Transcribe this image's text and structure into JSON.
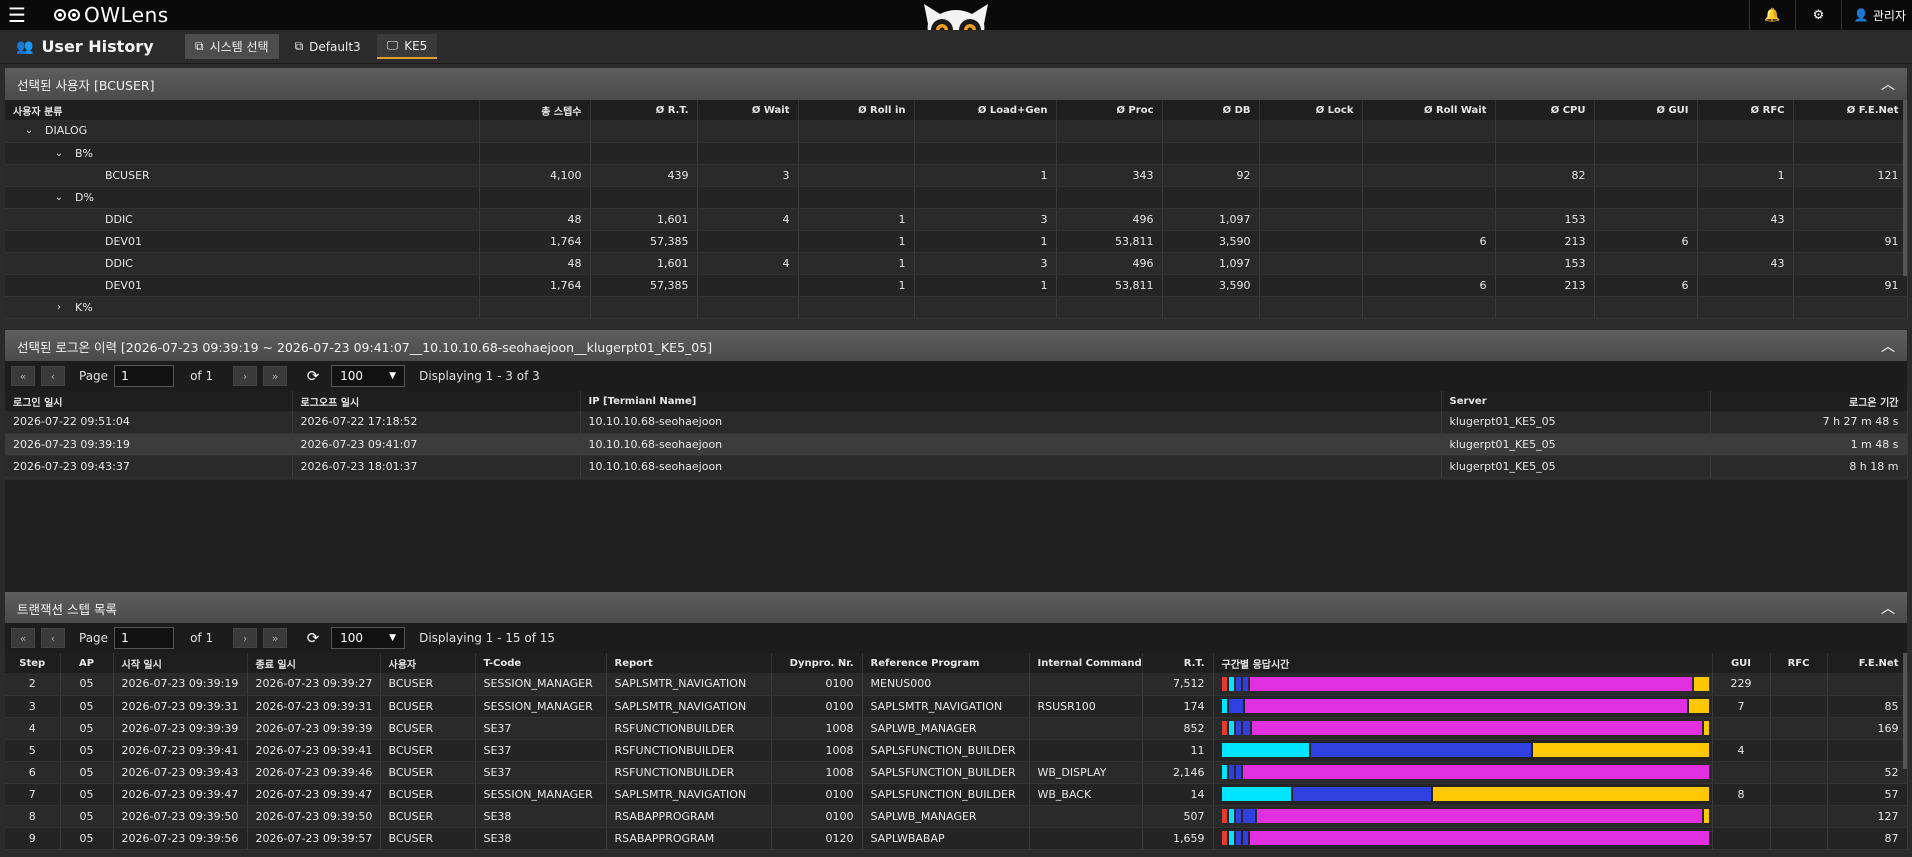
{
  "header": {
    "logo_text": "OWLens",
    "user_label": "관리자",
    "icons": [
      "menu-icon",
      "bell-icon",
      "settings-icon",
      "user-icon"
    ]
  },
  "subheader": {
    "page_title": "User History",
    "tabs": [
      {
        "label": "시스템 선택",
        "state": "active"
      },
      {
        "label": "Default3",
        "state": "normal"
      },
      {
        "label": "KE5",
        "state": "current"
      }
    ]
  },
  "panel1": {
    "title": "선택된 사용자 [BCUSER]",
    "columns": [
      "사용자 분류",
      "총 스텝수",
      "Ø R.T.",
      "Ø Wait",
      "Ø Roll in",
      "Ø Load+Gen",
      "Ø Proc",
      "Ø DB",
      "Ø Lock",
      "Ø Roll Wait",
      "Ø CPU",
      "Ø GUI",
      "Ø RFC",
      "Ø F.E.Net"
    ],
    "rows": [
      {
        "level": 0,
        "toggle": "⌄",
        "label": "DIALOG",
        "cells": [
          "",
          "",
          "",
          "",
          "",
          "",
          "",
          "",
          "",
          "",
          "",
          "",
          ""
        ]
      },
      {
        "level": 1,
        "toggle": "⌄",
        "label": "B%",
        "cells": [
          "",
          "",
          "",
          "",
          "",
          "",
          "",
          "",
          "",
          "",
          "",
          "",
          ""
        ]
      },
      {
        "level": 2,
        "toggle": "",
        "label": "BCUSER",
        "cells": [
          "4,100",
          "439",
          "3",
          "",
          "1",
          "343",
          "92",
          "",
          "",
          "82",
          "",
          "1",
          "121"
        ]
      },
      {
        "level": 1,
        "toggle": "⌄",
        "label": "D%",
        "cells": [
          "",
          "",
          "",
          "",
          "",
          "",
          "",
          "",
          "",
          "",
          "",
          "",
          ""
        ]
      },
      {
        "level": 2,
        "toggle": "",
        "label": "DDIC",
        "cells": [
          "48",
          "1,601",
          "4",
          "1",
          "3",
          "496",
          "1,097",
          "",
          "",
          "153",
          "",
          "43",
          ""
        ]
      },
      {
        "level": 2,
        "toggle": "",
        "label": "DEV01",
        "cells": [
          "1,764",
          "57,385",
          "",
          "1",
          "1",
          "53,811",
          "3,590",
          "",
          "6",
          "213",
          "6",
          "",
          "91"
        ]
      },
      {
        "level": 2,
        "toggle": "",
        "label": "DDIC",
        "cells": [
          "48",
          "1,601",
          "4",
          "1",
          "3",
          "496",
          "1,097",
          "",
          "",
          "153",
          "",
          "43",
          ""
        ]
      },
      {
        "level": 2,
        "toggle": "",
        "label": "DEV01",
        "cells": [
          "1,764",
          "57,385",
          "",
          "1",
          "1",
          "53,811",
          "3,590",
          "",
          "6",
          "213",
          "6",
          "",
          "91"
        ]
      },
      {
        "level": 1,
        "toggle": "›",
        "label": "K%",
        "cells": [
          "",
          "",
          "",
          "",
          "",
          "",
          "",
          "",
          "",
          "",
          "",
          "",
          ""
        ]
      }
    ]
  },
  "panel2": {
    "title": "선택된 로그온 이력 [2026-07-23 09:39:19 ~ 2026-07-23 09:41:07__10.10.10.68-seohaejoon__klugerpt01_KE5_05]",
    "pager": {
      "page_label": "Page",
      "page_value": "1",
      "of_label": "of 1",
      "page_size": "100",
      "displaying": "Displaying  1 - 3  of  3"
    },
    "columns": [
      "로그인 일시",
      "로그오프 일시",
      "IP [Termianl Name]",
      "Server",
      "로그온 기간"
    ],
    "rows": [
      [
        "2026-07-22 09:51:04",
        "2026-07-22 17:18:52",
        "10.10.10.68-seohaejoon",
        "klugerpt01_KE5_05",
        "7 h 27 m 48 s"
      ],
      [
        "2026-07-23 09:39:19",
        "2026-07-23 09:41:07",
        "10.10.10.68-seohaejoon",
        "klugerpt01_KE5_05",
        "1 m 48 s"
      ],
      [
        "2026-07-23 09:43:37",
        "2026-07-23 18:01:37",
        "10.10.10.68-seohaejoon",
        "klugerpt01_KE5_05",
        "8 h 18 m"
      ]
    ]
  },
  "panel3": {
    "title": "트랜잭션 스텝 목록",
    "pager": {
      "page_label": "Page",
      "page_value": "1",
      "of_label": "of 1",
      "page_size": "100",
      "displaying": "Displaying  1 - 15  of  15"
    },
    "columns": [
      "Step",
      "AP",
      "시작 일시",
      "종료 일시",
      "사용자",
      "T-Code",
      "Report",
      "Dynpro. Nr.",
      "Reference Program",
      "Internal Command",
      "R.T.",
      "구간별 응답시간",
      "GUI",
      "RFC",
      "F.E.Net"
    ],
    "colors": {
      "red": "#e53935",
      "cyan": "#00e5ff",
      "blue": "#3040e0",
      "magenta": "#e030e0",
      "yellow": "#ffc800"
    },
    "rows": [
      {
        "cells": [
          "2",
          "05",
          "2026-07-23 09:39:19",
          "2026-07-23 09:39:27",
          "BCUSER",
          "SESSION_MANAGER",
          "SAPLSMTR_NAVIGATION",
          "0100",
          "MENUS000",
          "",
          "7,512"
        ],
        "bar": [
          [
            "red",
            0.8
          ],
          [
            "cyan",
            0.8
          ],
          [
            "blue",
            0.8
          ],
          [
            "blue",
            1.2
          ],
          [
            "magenta",
            89
          ],
          [
            "yellow",
            3
          ]
        ],
        "tail": [
          "229",
          "",
          ""
        ]
      },
      {
        "cells": [
          "3",
          "05",
          "2026-07-23 09:39:31",
          "2026-07-23 09:39:31",
          "BCUSER",
          "SESSION_MANAGER",
          "SAPLSMTR_NAVIGATION",
          "0100",
          "SAPLSMTR_NAVIGATION",
          "RSUSR100",
          "174"
        ],
        "bar": [
          [
            "cyan",
            0.8
          ],
          [
            "blue",
            3
          ],
          [
            "magenta",
            89
          ],
          [
            "yellow",
            4
          ]
        ],
        "tail": [
          "7",
          "",
          "85"
        ]
      },
      {
        "cells": [
          "4",
          "05",
          "2026-07-23 09:39:39",
          "2026-07-23 09:39:39",
          "BCUSER",
          "SE37",
          "RSFUNCTIONBUILDER",
          "1008",
          "SAPLWB_MANAGER",
          "",
          "852"
        ],
        "bar": [
          [
            "red",
            0.8
          ],
          [
            "cyan",
            0.8
          ],
          [
            "blue",
            0.8
          ],
          [
            "blue",
            1.5
          ],
          [
            "magenta",
            91
          ],
          [
            "yellow",
            1
          ]
        ],
        "tail": [
          "",
          "",
          "169"
        ]
      },
      {
        "cells": [
          "5",
          "05",
          "2026-07-23 09:39:41",
          "2026-07-23 09:39:41",
          "BCUSER",
          "SE37",
          "RSFUNCTIONBUILDER",
          "1008",
          "SAPLSFUNCTION_BUILDER",
          "",
          "11"
        ],
        "bar": [
          [
            "cyan",
            18
          ],
          [
            "blue",
            45
          ],
          [
            "yellow",
            36
          ]
        ],
        "tail": [
          "4",
          "",
          ""
        ]
      },
      {
        "cells": [
          "6",
          "05",
          "2026-07-23 09:39:43",
          "2026-07-23 09:39:46",
          "BCUSER",
          "SE37",
          "RSFUNCTIONBUILDER",
          "1008",
          "SAPLSFUNCTION_BUILDER",
          "WB_DISPLAY",
          "2,146"
        ],
        "bar": [
          [
            "cyan",
            0.8
          ],
          [
            "blue",
            0.8
          ],
          [
            "blue",
            0.8
          ],
          [
            "magenta",
            95
          ]
        ],
        "tail": [
          "",
          "",
          "52"
        ]
      },
      {
        "cells": [
          "7",
          "05",
          "2026-07-23 09:39:47",
          "2026-07-23 09:39:47",
          "BCUSER",
          "SESSION_MANAGER",
          "SAPLSMTR_NAVIGATION",
          "0100",
          "SAPLSFUNCTION_BUILDER",
          "WB_BACK",
          "14"
        ],
        "bar": [
          [
            "cyan",
            14
          ],
          [
            "blue",
            28
          ],
          [
            "yellow",
            56
          ]
        ],
        "tail": [
          "8",
          "",
          "57"
        ]
      },
      {
        "cells": [
          "8",
          "05",
          "2026-07-23 09:39:50",
          "2026-07-23 09:39:50",
          "BCUSER",
          "SE38",
          "RSABAPPROGRAM",
          "0100",
          "SAPLWB_MANAGER",
          "",
          "507"
        ],
        "bar": [
          [
            "red",
            0.8
          ],
          [
            "cyan",
            0.8
          ],
          [
            "blue",
            0.8
          ],
          [
            "blue",
            2.5
          ],
          [
            "magenta",
            91
          ],
          [
            "yellow",
            1
          ]
        ],
        "tail": [
          "",
          "",
          "127"
        ]
      },
      {
        "cells": [
          "9",
          "05",
          "2026-07-23 09:39:56",
          "2026-07-23 09:39:57",
          "BCUSER",
          "SE38",
          "RSABAPPROGRAM",
          "0120",
          "SAPLWBABAP",
          "",
          "1,659"
        ],
        "bar": [
          [
            "red",
            0.8
          ],
          [
            "cyan",
            0.8
          ],
          [
            "blue",
            0.8
          ],
          [
            "blue",
            0.5
          ],
          [
            "magenta",
            94
          ]
        ],
        "tail": [
          "",
          "",
          "87"
        ]
      }
    ]
  }
}
